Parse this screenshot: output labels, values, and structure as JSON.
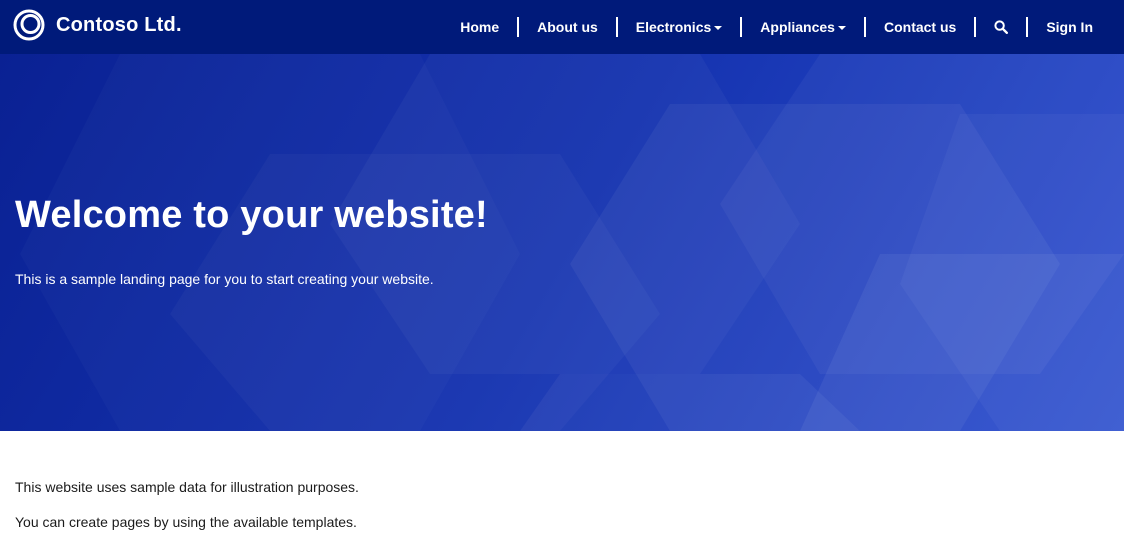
{
  "brand": {
    "name": "Contoso Ltd.",
    "logo_icon": "contoso-ring-logo"
  },
  "nav": {
    "items": [
      {
        "label": "Home"
      },
      {
        "label": "About us"
      },
      {
        "label": "Electronics",
        "dropdown": true
      },
      {
        "label": "Appliances",
        "dropdown": true
      },
      {
        "label": "Contact us"
      }
    ],
    "search_icon": "search-icon",
    "sign_in": "Sign In"
  },
  "hero": {
    "title": "Welcome to your website!",
    "subtitle": "This is a sample landing page for you to start creating your website."
  },
  "content": {
    "paragraphs": [
      "This website uses sample data for illustration purposes.",
      "You can create pages by using the available templates."
    ]
  },
  "colors": {
    "navbar": "#001a7a",
    "hero_start": "#0a2193",
    "hero_end": "#2e50cf",
    "text": "#1b1b1b"
  }
}
